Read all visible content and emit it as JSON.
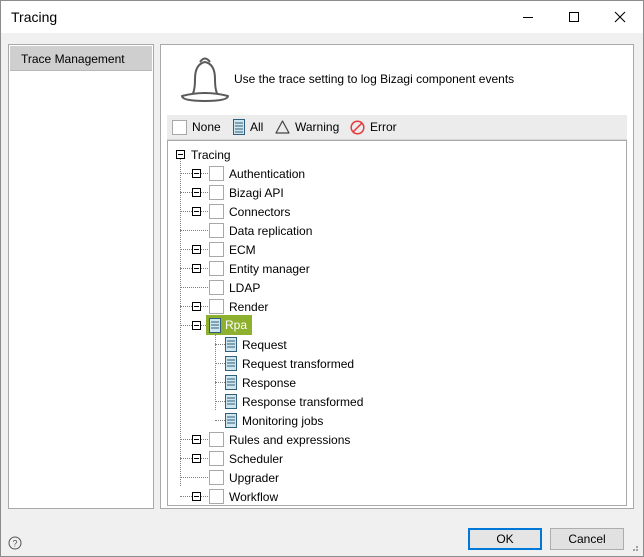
{
  "window": {
    "title": "Tracing"
  },
  "sidebar": {
    "items": [
      {
        "label": "Trace Management"
      }
    ]
  },
  "main": {
    "description": "Use the trace setting to log Bizagi component events",
    "filters": {
      "none": "None",
      "all": "All",
      "warning": "Warning",
      "error": "Error"
    },
    "tree": {
      "root": "Tracing",
      "items": [
        {
          "label": "Authentication",
          "expandable": true,
          "state": "none"
        },
        {
          "label": "Bizagi API",
          "expandable": true,
          "state": "none"
        },
        {
          "label": "Connectors",
          "expandable": true,
          "state": "none"
        },
        {
          "label": "Data replication",
          "expandable": false,
          "state": "none"
        },
        {
          "label": "ECM",
          "expandable": true,
          "state": "none"
        },
        {
          "label": "Entity manager",
          "expandable": true,
          "state": "none"
        },
        {
          "label": "LDAP",
          "expandable": false,
          "state": "none"
        },
        {
          "label": "Render",
          "expandable": true,
          "state": "none"
        },
        {
          "label": "Rpa",
          "expandable": true,
          "state": "all",
          "selected": true,
          "children": [
            {
              "label": "Request",
              "state": "all"
            },
            {
              "label": "Request transformed",
              "state": "all"
            },
            {
              "label": "Response",
              "state": "all"
            },
            {
              "label": "Response transformed",
              "state": "all"
            },
            {
              "label": "Monitoring jobs",
              "state": "all"
            }
          ]
        },
        {
          "label": "Rules and expressions",
          "expandable": true,
          "state": "none"
        },
        {
          "label": "Scheduler",
          "expandable": true,
          "state": "none"
        },
        {
          "label": "Upgrader",
          "expandable": false,
          "state": "none"
        },
        {
          "label": "Workflow",
          "expandable": true,
          "state": "none"
        }
      ]
    }
  },
  "buttons": {
    "ok": "OK",
    "cancel": "Cancel"
  },
  "colors": {
    "selection": "#8db12e",
    "accent": "#0078d7",
    "error": "#e5393b"
  },
  "icons": {
    "bell": "bell-icon",
    "help": "help-icon",
    "all": "log-all-icon",
    "warning": "warning-triangle-icon",
    "error": "no-entry-icon"
  }
}
